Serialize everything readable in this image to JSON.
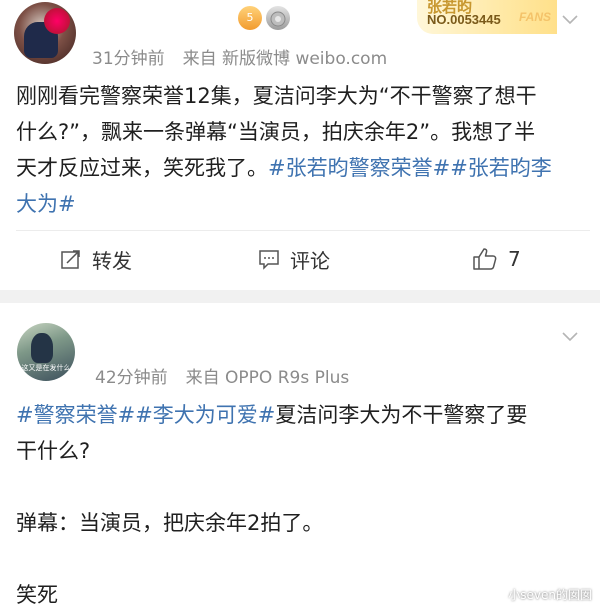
{
  "post1": {
    "avatar_icon": "user-avatar-photo",
    "badges": [
      "crown-badge-icon",
      "medal-badge-icon"
    ],
    "badge_crown_text": "5",
    "badge_medal_text": "",
    "fans_card": {
      "name": "张若昀",
      "number": "NO.0053445",
      "tag": "FANS"
    },
    "time": "31分钟前",
    "source": "来自 新版微博 weibo.com",
    "text_lines": [
      [
        {
          "t": "刚刚看完警察荣誉12集，夏洁问李大为“不干警察了想干",
          "tag": false
        }
      ],
      [
        {
          "t": "什么?”，飘来一条弹幕“当演员，拍庆余年2”。我想了半",
          "tag": false
        }
      ],
      [
        {
          "t": "天才反应过来，笑死我了。",
          "tag": false
        },
        {
          "t": "#张若昀警察荣誉##张若昀李",
          "tag": true
        }
      ],
      [
        {
          "t": "大为#",
          "tag": true
        }
      ]
    ],
    "actions": {
      "share_label": "转发",
      "comment_label": "评论",
      "like_count": "7"
    }
  },
  "post2": {
    "avatar_icon": "user-avatar-photo",
    "avatar_caption": "这又是在发什么",
    "time": "42分钟前",
    "source": "来自 OPPO R9s Plus",
    "text_lines": [
      [
        {
          "t": "#警察荣誉##李大为可爱#",
          "tag": true
        },
        {
          "t": "夏洁问李大为不干警察了要",
          "tag": false
        }
      ],
      [
        {
          "t": "干什么?",
          "tag": false
        }
      ],
      [],
      [
        {
          "t": "弹幕：当演员，把庆余年2拍了。",
          "tag": false
        }
      ],
      [],
      [
        {
          "t": "笑死",
          "tag": false
        }
      ]
    ]
  },
  "watermark": "小seven的囡囡",
  "colors": {
    "tag": "#3f73b0",
    "meta": "#8b8b8b",
    "separator": "#f1f1f1"
  }
}
